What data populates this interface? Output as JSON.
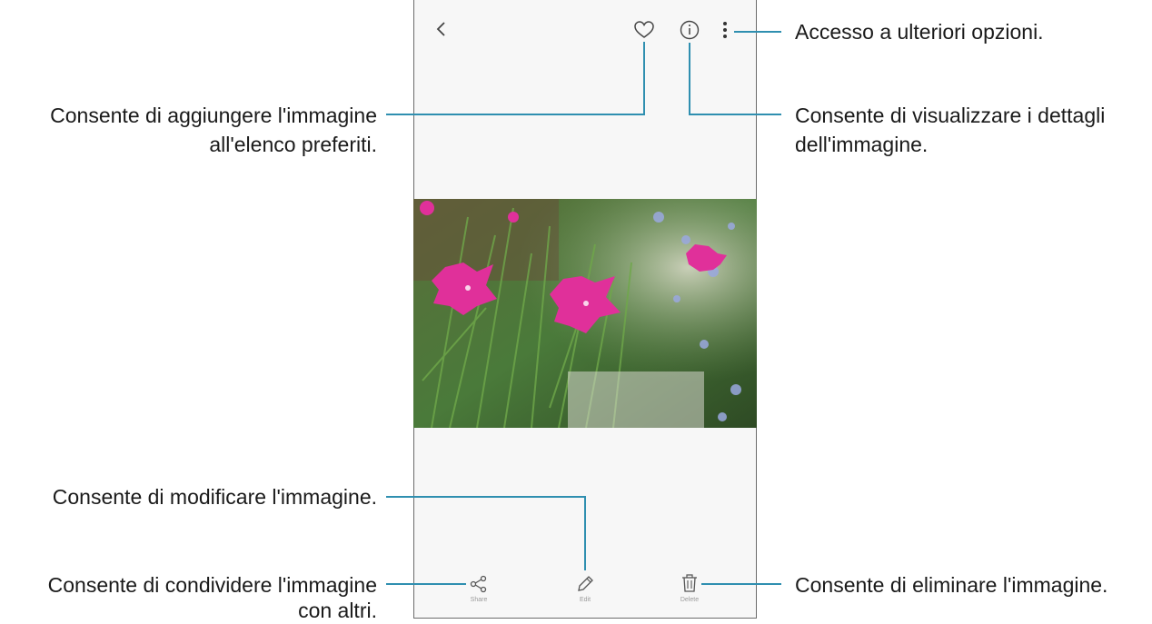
{
  "toolbar": {
    "back_icon": "chevron-left-icon",
    "favorite_icon": "heart-icon",
    "info_icon": "info-icon",
    "more_icon": "vertical-ellipsis-icon"
  },
  "bottom_bar": {
    "share_label": "Share",
    "edit_label": "Edit",
    "delete_label": "Delete",
    "share_icon": "share-icon",
    "edit_icon": "pencil-icon",
    "delete_icon": "trash-icon"
  },
  "callouts": {
    "more_options": "Accesso a ulteriori opzioni.",
    "favorites_line1": "Consente di aggiungere l'immagine",
    "favorites_line2": "all'elenco preferiti.",
    "details_line1": "Consente di visualizzare i dettagli",
    "details_line2": "dell'immagine.",
    "edit": "Consente di modificare l'immagine.",
    "share_line1": "Consente di condividere l'immagine",
    "share_line2": "con altri.",
    "delete": "Consente di eliminare l'immagine."
  },
  "colors": {
    "callout_line": "#2f8fb0",
    "flower_pink": "#e0309a",
    "foliage": "#3f7a33"
  }
}
